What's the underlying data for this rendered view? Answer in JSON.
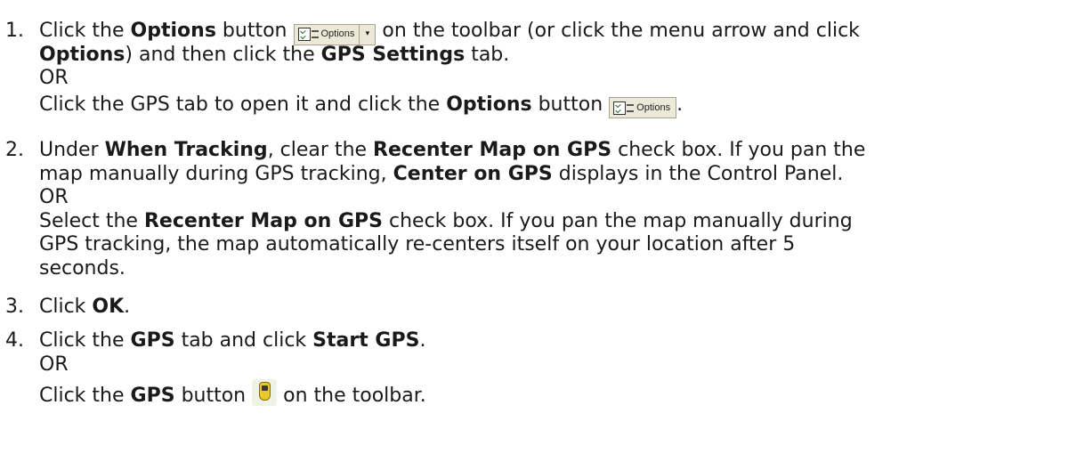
{
  "steps": [
    {
      "number": "1.",
      "line1": {
        "a": "Click the",
        "b": "Options",
        "c": "button",
        "d": "on the toolbar (or click the menu arrow and click"
      },
      "line2": {
        "a": "Options",
        "b": ") and then click the",
        "c": "GPS Settings",
        "d": "tab."
      },
      "line3": "OR",
      "line4": {
        "a": "Click the GPS tab to open it and click the",
        "b": "Options",
        "c": "button",
        "d": "."
      }
    },
    {
      "number": "2.",
      "line1": {
        "a": "Under",
        "b": "When Tracking",
        "c": ", clear the",
        "d": "Recenter Map on GPS",
        "e": "check box. If you pan the"
      },
      "line2": {
        "a": "map manually during GPS tracking,",
        "b": "Center on GPS",
        "c": "displays in the Control Panel."
      },
      "line3": "OR",
      "line4": {
        "a": "Select the",
        "b": "Recenter Map on GPS",
        "c": "check box. If you pan the map manually during"
      },
      "line5": "GPS tracking, the map automatically re-centers itself on your location after 5",
      "line6": "seconds."
    },
    {
      "number": "3.",
      "line1": {
        "a": "Click",
        "b": "OK",
        "c": "."
      }
    },
    {
      "number": "4.",
      "line1": {
        "a": "Click the",
        "b": "GPS",
        "c": "tab and click",
        "d": "Start GPS",
        "e": "."
      },
      "line2": "OR",
      "line3": {
        "a": "Click the",
        "b": "GPS",
        "c": "button",
        "d": "on the toolbar."
      }
    }
  ],
  "toolbar": {
    "options_label": "Options",
    "options_menu_arrow": "▾",
    "options_icon": "options-checklist-icon",
    "gps_icon": "gps-device-icon",
    "gps_color": "#e9c82e"
  }
}
